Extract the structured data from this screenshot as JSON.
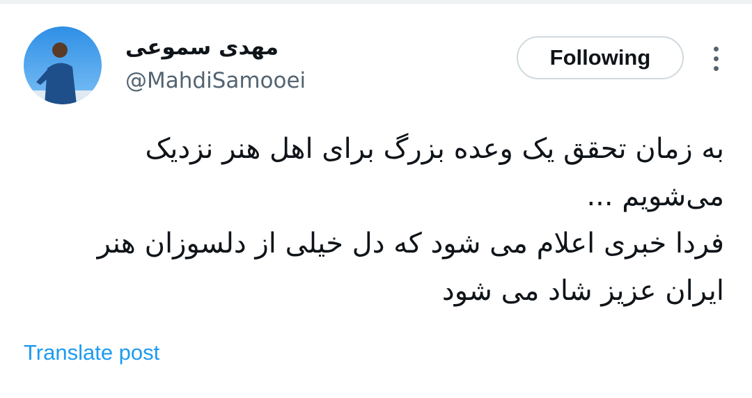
{
  "author": {
    "display_name": "مهدی سموعی",
    "handle": "@MahdiSamooei"
  },
  "actions": {
    "follow_label": "Following",
    "more_icon": "more-vertical-icon"
  },
  "tweet": {
    "lines": [
      "به زمان تحقق یک وعده بزرگ برای اهل هنر نزدیک",
      "می‌شویم ...",
      "فردا خبری اعلام می شود که دل خیلی از دلسوزان هنر",
      "ایران عزیز شاد می شود"
    ]
  },
  "translate_label": "Translate post",
  "colors": {
    "link": "#1d9bf0",
    "secondary_text": "#536471",
    "button_border": "#cfd9de"
  }
}
